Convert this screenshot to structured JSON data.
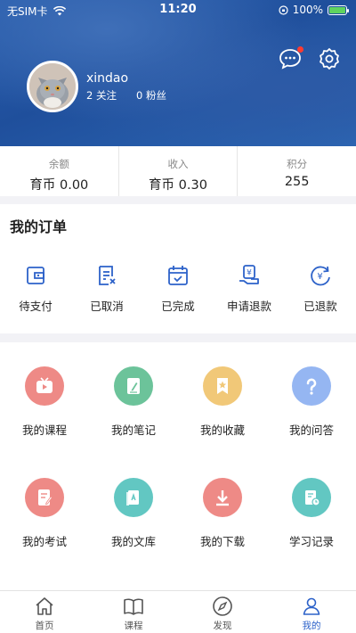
{
  "status_bar": {
    "carrier": "无SIM卡",
    "time": "11:20",
    "battery": "100%"
  },
  "profile": {
    "username": "xindao",
    "follow": "2 关注",
    "fans": "0 粉丝"
  },
  "stats": [
    {
      "label": "余额",
      "value": "育币 0.00"
    },
    {
      "label": "收入",
      "value": "育币 0.30"
    },
    {
      "label": "积分",
      "value": "255"
    }
  ],
  "orders": {
    "title": "我的订单",
    "items": [
      {
        "label": "待支付",
        "icon": "wallet-icon"
      },
      {
        "label": "已取消",
        "icon": "cancelled-doc-icon"
      },
      {
        "label": "已完成",
        "icon": "calendar-check-icon"
      },
      {
        "label": "申请退款",
        "icon": "refund-request-icon"
      },
      {
        "label": "已退款",
        "icon": "refunded-icon"
      }
    ]
  },
  "grid": [
    {
      "label": "我的课程",
      "icon": "tv-play-icon",
      "color": "#ee8a86"
    },
    {
      "label": "我的笔记",
      "icon": "note-pen-icon",
      "color": "#6cc39a"
    },
    {
      "label": "我的收藏",
      "icon": "bookmark-star-icon",
      "color": "#f1c878"
    },
    {
      "label": "我的问答",
      "icon": "question-icon",
      "color": "#95b6f2"
    },
    {
      "label": "我的考试",
      "icon": "exam-paper-icon",
      "color": "#ee8a86"
    },
    {
      "label": "我的文库",
      "icon": "library-book-icon",
      "color": "#62c7c2"
    },
    {
      "label": "我的下载",
      "icon": "download-icon",
      "color": "#ee8a86"
    },
    {
      "label": "学习记录",
      "icon": "study-record-icon",
      "color": "#62c7c2"
    }
  ],
  "tabs": [
    {
      "label": "首页",
      "icon": "home-icon"
    },
    {
      "label": "课程",
      "icon": "book-icon"
    },
    {
      "label": "发现",
      "icon": "compass-icon"
    },
    {
      "label": "我的",
      "icon": "user-icon",
      "active": true
    }
  ],
  "colors": {
    "accent": "#2d62c9",
    "header": "#2a5fae",
    "notification_dot": "#ff3b30"
  }
}
